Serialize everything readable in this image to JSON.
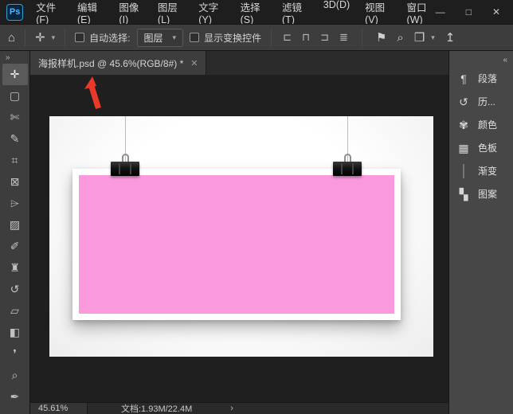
{
  "window": {
    "logo": "Ps",
    "controls": {
      "minimize": "—",
      "maximize": "□",
      "close": "✕"
    }
  },
  "menu": {
    "items": [
      "文件(F)",
      "编辑(E)",
      "图像(I)",
      "图层(L)",
      "文字(Y)",
      "选择(S)",
      "滤镜(T)",
      "3D(D)",
      "视图(V)",
      "窗口(W)"
    ]
  },
  "options_bar": {
    "home_glyph": "⌂",
    "move_glyph": "✛",
    "chevron": "▾",
    "auto_select_label": "自动选择:",
    "layer_dropdown_value": "图层",
    "show_transform_label": "显示变换控件",
    "align_glyphs": [
      "⊏",
      "⊓",
      "⊐",
      "≣"
    ],
    "flag_glyph": "⚑",
    "search_glyph": "⌕",
    "arrange_glyph": "❒",
    "share_glyph": "↥"
  },
  "tabbar": {
    "tab_title": "海报样机.psd @ 45.6%(RGB/8#) *",
    "close_glyph": "✕"
  },
  "toolbar": {
    "collapse_glyph": "»",
    "tools": [
      {
        "name": "move",
        "glyph": "✛"
      },
      {
        "name": "rectangular-marquee",
        "glyph": "▢"
      },
      {
        "name": "lasso",
        "glyph": "✄"
      },
      {
        "name": "quick-selection",
        "glyph": "✎"
      },
      {
        "name": "crop",
        "glyph": "⌗"
      },
      {
        "name": "frame",
        "glyph": "⊠"
      },
      {
        "name": "eyedropper",
        "glyph": "⌲"
      },
      {
        "name": "healing-brush",
        "glyph": "▨"
      },
      {
        "name": "brush",
        "glyph": "✐"
      },
      {
        "name": "clone-stamp",
        "glyph": "♜"
      },
      {
        "name": "history-brush",
        "glyph": "↺"
      },
      {
        "name": "eraser",
        "glyph": "▱"
      },
      {
        "name": "gradient",
        "glyph": "◧"
      },
      {
        "name": "blur",
        "glyph": "❜"
      },
      {
        "name": "dodge",
        "glyph": "⌕"
      },
      {
        "name": "pen",
        "glyph": "✒"
      }
    ]
  },
  "dock": {
    "collapse_glyph": "«",
    "panels": [
      {
        "label": "段落",
        "glyph": "¶",
        "icon": "paragraph-icon"
      },
      {
        "label": "历...",
        "glyph": "↺",
        "icon": "history-icon"
      },
      {
        "label": "颜色",
        "glyph": "✾",
        "icon": "color-icon"
      },
      {
        "label": "色板",
        "glyph": "▦",
        "icon": "swatches-icon"
      },
      {
        "label": "渐变",
        "glyph": "",
        "icon": "gradient-swatch-icon"
      },
      {
        "label": "图案",
        "glyph": "▚",
        "icon": "pattern-icon"
      }
    ]
  },
  "statusbar": {
    "zoom_value": "45.61%",
    "document_info": "文档:1.93M/22.4M",
    "chevron": "›"
  },
  "canvas": {
    "poster_color": "#fa99dc",
    "arrow_color": "#e8392b",
    "pasteboard_color": "#1f1f1f"
  }
}
